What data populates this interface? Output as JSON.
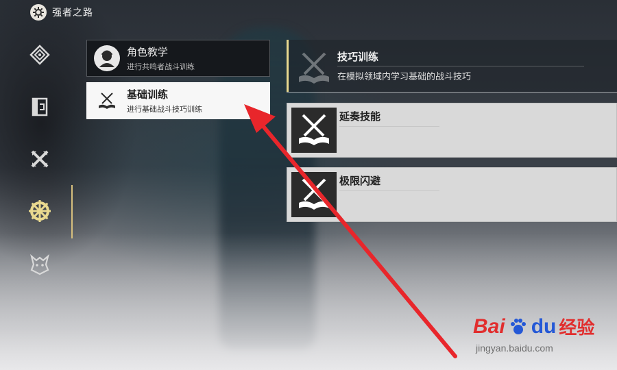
{
  "header": {
    "title": "强者之路",
    "icon": "gear-icon"
  },
  "rail": {
    "items": [
      {
        "name": "diamond-emblem-icon"
      },
      {
        "name": "gate-icon"
      },
      {
        "name": "crossed-blades-icon"
      },
      {
        "name": "gear-wheel-icon",
        "active": true
      },
      {
        "name": "beast-head-icon"
      }
    ],
    "active_color": "#e9d98f"
  },
  "menu": {
    "items": [
      {
        "title": "角色教学",
        "subtitle": "进行共鸣者战斗训练"
      },
      {
        "title": "基础训练",
        "subtitle": "进行基础战斗技巧训练",
        "selected": true
      }
    ]
  },
  "detail": {
    "title": "技巧训练",
    "description": "在模拟领域内学习基础的战斗技巧",
    "skills": [
      {
        "name": "延奏技能"
      },
      {
        "name": "极限闪避"
      }
    ]
  },
  "watermark": {
    "bai": "Bai",
    "du": "du",
    "jingyan": "经验",
    "url": "jingyan.baidu.com"
  },
  "colors": {
    "accent": "#e9d98f",
    "annotation": "#e8262b"
  }
}
